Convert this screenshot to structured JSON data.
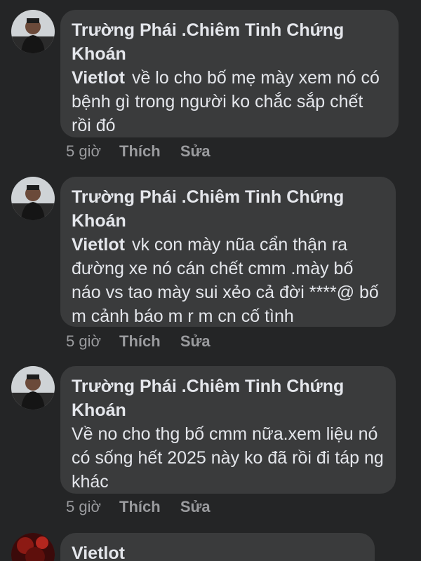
{
  "comments": [
    {
      "author": "Trường Phái .Chiêm Tinh Chứng Khoán",
      "mention": "Vietlot",
      "text": "về lo cho bố mẹ mày xem nó có bệnh gì trong người ko chắc sắp chết rồi đó",
      "time": "5 giờ",
      "like_label": "Thích",
      "edit_label": "Sửa"
    },
    {
      "author": "Trường Phái .Chiêm Tinh Chứng Khoán",
      "mention": "Vietlot",
      "text": "vk con mày nũa cẩn thận ra đường xe nó cán chết cmm .mày  bố náo vs tao mày sui xẻo cả đời ****@ bố m cảnh báo m r m cn cố tình",
      "time": "5 giờ",
      "like_label": "Thích",
      "edit_label": "Sửa"
    },
    {
      "author": "Trường Phái .Chiêm Tinh Chứng Khoán",
      "text": "Về no cho thg bố cmm nữa.xem liệu nó có sống hết 2025 này ko đã rồi đi táp ng khác",
      "time": "5 giờ",
      "like_label": "Thích",
      "edit_label": "Sửa"
    },
    {
      "author": "Vietlot"
    }
  ],
  "colors": {
    "background": "#242526",
    "bubble": "#3a3b3c",
    "text": "#e4e6eb",
    "muted": "#9a9b9e"
  }
}
